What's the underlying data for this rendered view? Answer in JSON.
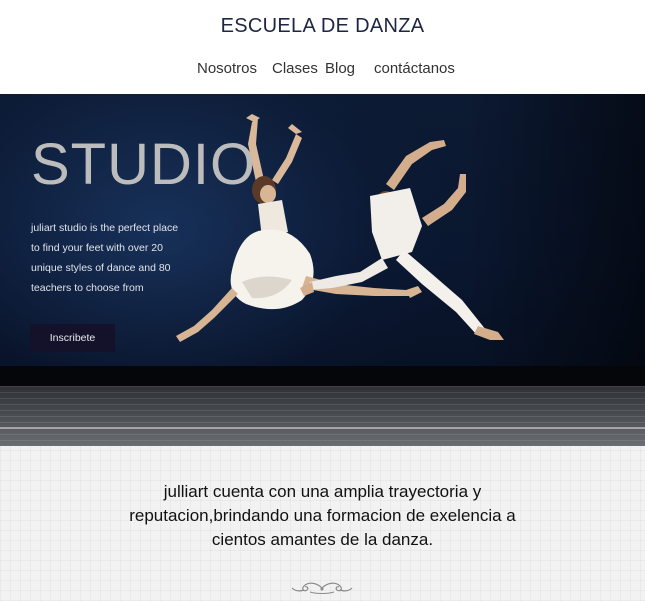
{
  "header": {
    "title": "ESCUELA DE DANZA",
    "nav": [
      {
        "label": "Nosotros"
      },
      {
        "label": "Clases"
      },
      {
        "label": "Blog"
      },
      {
        "label": "contáctanos"
      }
    ]
  },
  "hero": {
    "title": "STUDIO",
    "lines": [
      "juliart studio is the perfect place",
      "to find your feet with over 20",
      "unique styles of dance and 80",
      "teachers to choose from"
    ],
    "button_label": "Inscribete"
  },
  "about": {
    "lines": [
      "julliart cuenta con una amplia trayectoria y",
      "reputacion,brindando una formacion de exelencia a",
      "cientos amantes de la danza."
    ]
  },
  "colors": {
    "title": "#1d2642",
    "hero_bg": "#0a1730",
    "button_bg": "#14112a",
    "section_bg": "#f2f2f2"
  },
  "icons": {
    "ornament": "scroll-divider-icon"
  }
}
